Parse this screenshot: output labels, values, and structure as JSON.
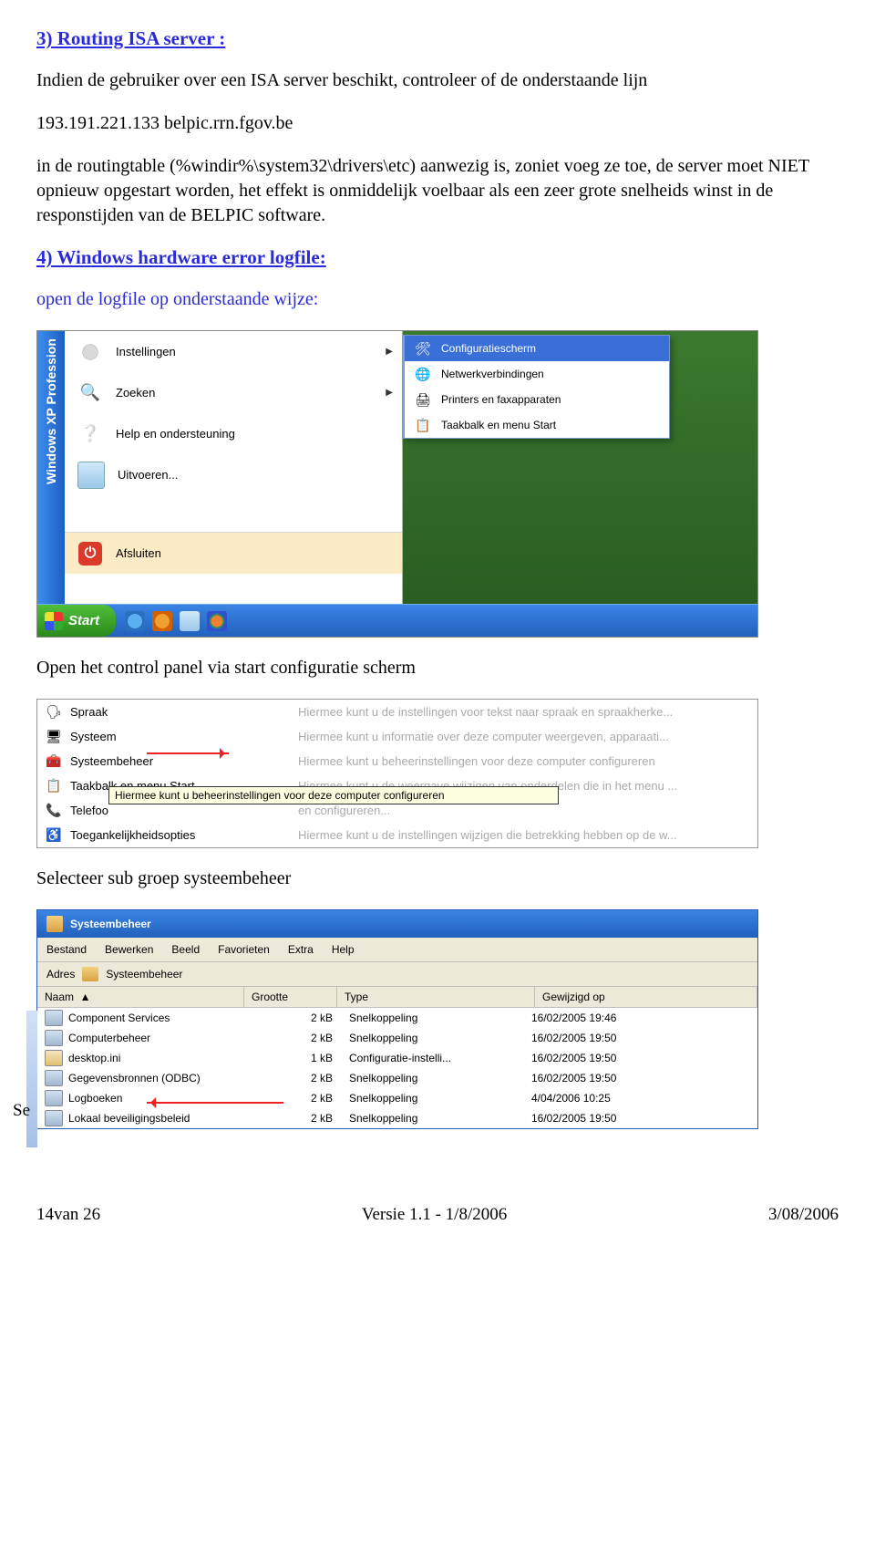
{
  "section3": {
    "heading": "3) Routing ISA server :",
    "para1": "Indien de gebruiker over een ISA server beschikt, controleer of de onderstaande lijn",
    "para2": "193.191.221.133 belpic.rrn.fgov.be",
    "para3": "in de routingtable (%windir%\\system32\\drivers\\etc) aanwezig is, zoniet voeg ze toe, de server moet NIET opnieuw opgestart worden, het effekt is onmiddelijk voelbaar als een zeer grote snelheids winst in de responstijden van de BELPIC software."
  },
  "section4": {
    "heading": "4) Windows hardware error logfile:",
    "intro": "open de logfile op onderstaande wijze:",
    "after1": "Open het control panel via start configuratie scherm",
    "after2": "Selecteer sub groep systeembeheer",
    "cutoff": "Se"
  },
  "startmenu": {
    "sidebar": "Windows XP Profession",
    "items": [
      {
        "label": "Instellingen",
        "arrow": true
      },
      {
        "label": "Zoeken",
        "arrow": true
      },
      {
        "label": "Help en ondersteuning",
        "arrow": false
      },
      {
        "label": "Uitvoeren...",
        "arrow": false
      },
      {
        "label": "Afsluiten",
        "arrow": false
      }
    ],
    "submenu": [
      {
        "label": "Configuratiescherm",
        "hl": true
      },
      {
        "label": "Netwerkverbindingen",
        "hl": false
      },
      {
        "label": "Printers en faxapparaten",
        "hl": false
      },
      {
        "label": "Taakbalk en menu Start",
        "hl": false
      }
    ],
    "start_label": "Start"
  },
  "cpl": {
    "rows": [
      {
        "name": "Spraak",
        "desc": "Hiermee kunt u de instellingen voor tekst naar spraak en spraakherke..."
      },
      {
        "name": "Systeem",
        "desc": "Hiermee kunt u informatie over deze computer weergeven, apparaati..."
      },
      {
        "name": "Systeembeheer",
        "desc": "Hiermee kunt u beheerinstellingen voor deze computer configureren"
      },
      {
        "name": "Taakbalk en menu Start",
        "desc": "Hiermee kunt u de weergave wijzigen van onderdelen die in het menu ..."
      },
      {
        "name": "Telefoo",
        "desc": "en configureren..."
      },
      {
        "name": "Toegankelijkheidsopties",
        "desc": "Hiermee kunt u de instellingen wijzigen die betrekking hebben op de w..."
      }
    ],
    "tooltip": "Hiermee kunt u beheerinstellingen voor deze computer configureren"
  },
  "explorer": {
    "title": "Systeembeheer",
    "menu": [
      "Bestand",
      "Bewerken",
      "Beeld",
      "Favorieten",
      "Extra",
      "Help"
    ],
    "addr_label": "Adres",
    "addr_val": "Systeembeheer",
    "cols": {
      "name": "Naam",
      "size": "Grootte",
      "type": "Type",
      "date": "Gewijzigd op"
    },
    "rows": [
      {
        "name": "Component Services",
        "size": "2 kB",
        "type": "Snelkoppeling",
        "date": "16/02/2005 19:46"
      },
      {
        "name": "Computerbeheer",
        "size": "2 kB",
        "type": "Snelkoppeling",
        "date": "16/02/2005 19:50"
      },
      {
        "name": "desktop.ini",
        "size": "1 kB",
        "type": "Configuratie-instelli...",
        "date": "16/02/2005 19:50"
      },
      {
        "name": "Gegevensbronnen (ODBC)",
        "size": "2 kB",
        "type": "Snelkoppeling",
        "date": "16/02/2005 19:50"
      },
      {
        "name": "Logboeken",
        "size": "2 kB",
        "type": "Snelkoppeling",
        "date": "4/04/2006 10:25"
      },
      {
        "name": "Lokaal beveiligingsbeleid",
        "size": "2 kB",
        "type": "Snelkoppeling",
        "date": "16/02/2005 19:50"
      }
    ]
  },
  "footer": {
    "left": "14van 26",
    "center": "Versie 1.1  -  1/8/2006",
    "right": "3/08/2006"
  }
}
